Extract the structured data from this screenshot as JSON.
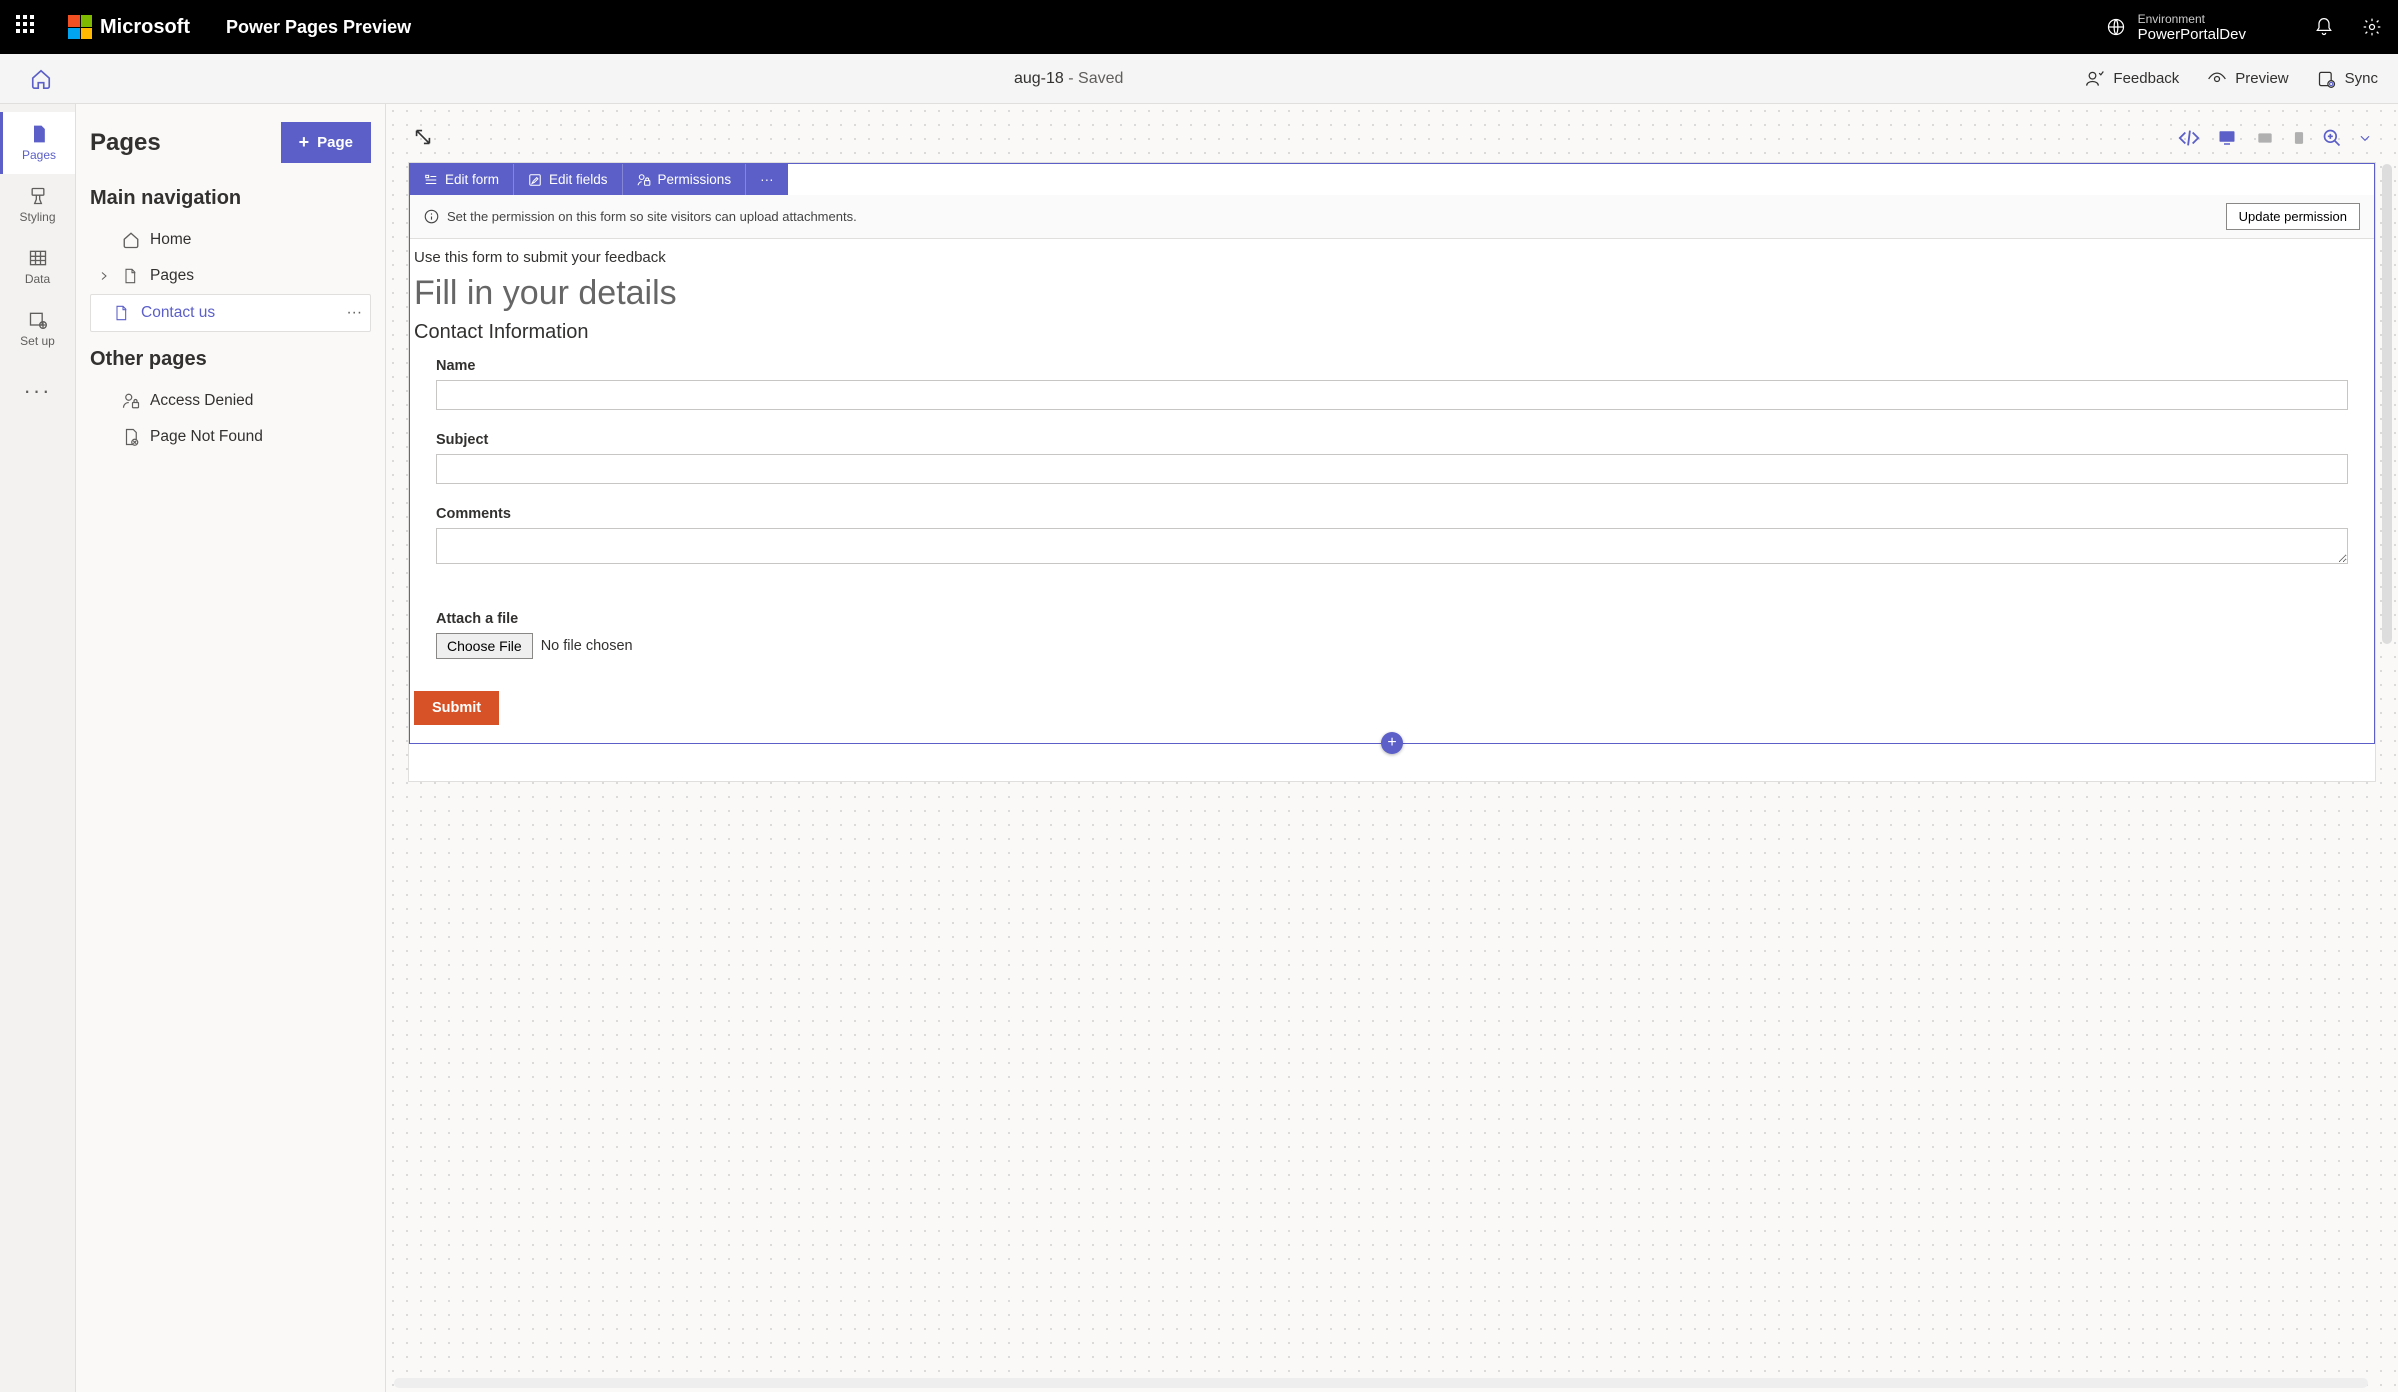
{
  "header": {
    "brand": "Microsoft",
    "product": "Power Pages Preview",
    "environment_label": "Environment",
    "environment_name": "PowerPortalDev"
  },
  "command_bar": {
    "site_name": "aug-18",
    "status": " - Saved",
    "feedback": "Feedback",
    "preview": "Preview",
    "sync": "Sync"
  },
  "rail": {
    "pages": "Pages",
    "styling": "Styling",
    "data": "Data",
    "setup": "Set up"
  },
  "panel": {
    "title": "Pages",
    "new_page": "Page",
    "section_main": "Main navigation",
    "item_home": "Home",
    "item_pages": "Pages",
    "item_contact": "Contact us",
    "section_other": "Other pages",
    "item_access_denied": "Access Denied",
    "item_not_found": "Page Not Found"
  },
  "form_toolbar": {
    "edit_form": "Edit form",
    "edit_fields": "Edit fields",
    "permissions": "Permissions"
  },
  "notice": {
    "text": "Set the permission on this form so site visitors can upload attachments.",
    "button": "Update permission"
  },
  "form": {
    "description": "Use this form to submit your feedback",
    "heading": "Fill in your details",
    "section": "Contact Information",
    "name_label": "Name",
    "subject_label": "Subject",
    "comments_label": "Comments",
    "attach_label": "Attach a file",
    "choose_file": "Choose File",
    "no_file": "No file chosen",
    "submit": "Submit"
  }
}
